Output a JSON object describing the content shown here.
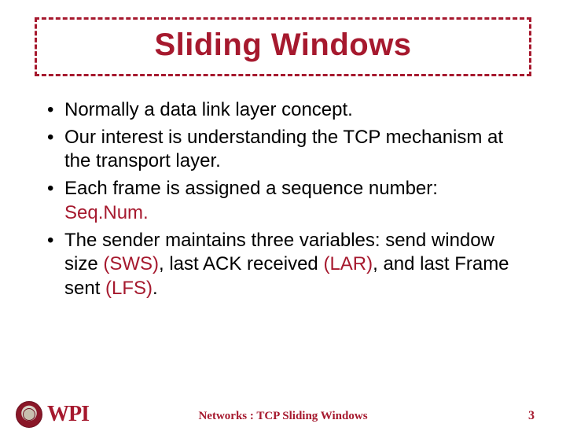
{
  "title": "Sliding Windows",
  "bullets": [
    {
      "text": "Normally a data link layer concept."
    },
    {
      "text_before": "Our interest is understanding the TCP mechanism at the transport layer."
    },
    {
      "text_before": "Each frame is assigned a sequence number: ",
      "em": "Seq.Num."
    },
    {
      "composite": true,
      "parts": [
        {
          "t": "The sender maintains three variables: send window size "
        },
        {
          "t": "(SWS)",
          "red": true
        },
        {
          "t": ", last ACK received "
        },
        {
          "t": "(LAR)",
          "red": true
        },
        {
          "t": ", and last Frame sent "
        },
        {
          "t": "(LFS)",
          "red": true
        },
        {
          "t": "."
        }
      ]
    }
  ],
  "footer": {
    "logo_text": "WPI",
    "center": "Networks : TCP Sliding Windows",
    "page": "3"
  }
}
